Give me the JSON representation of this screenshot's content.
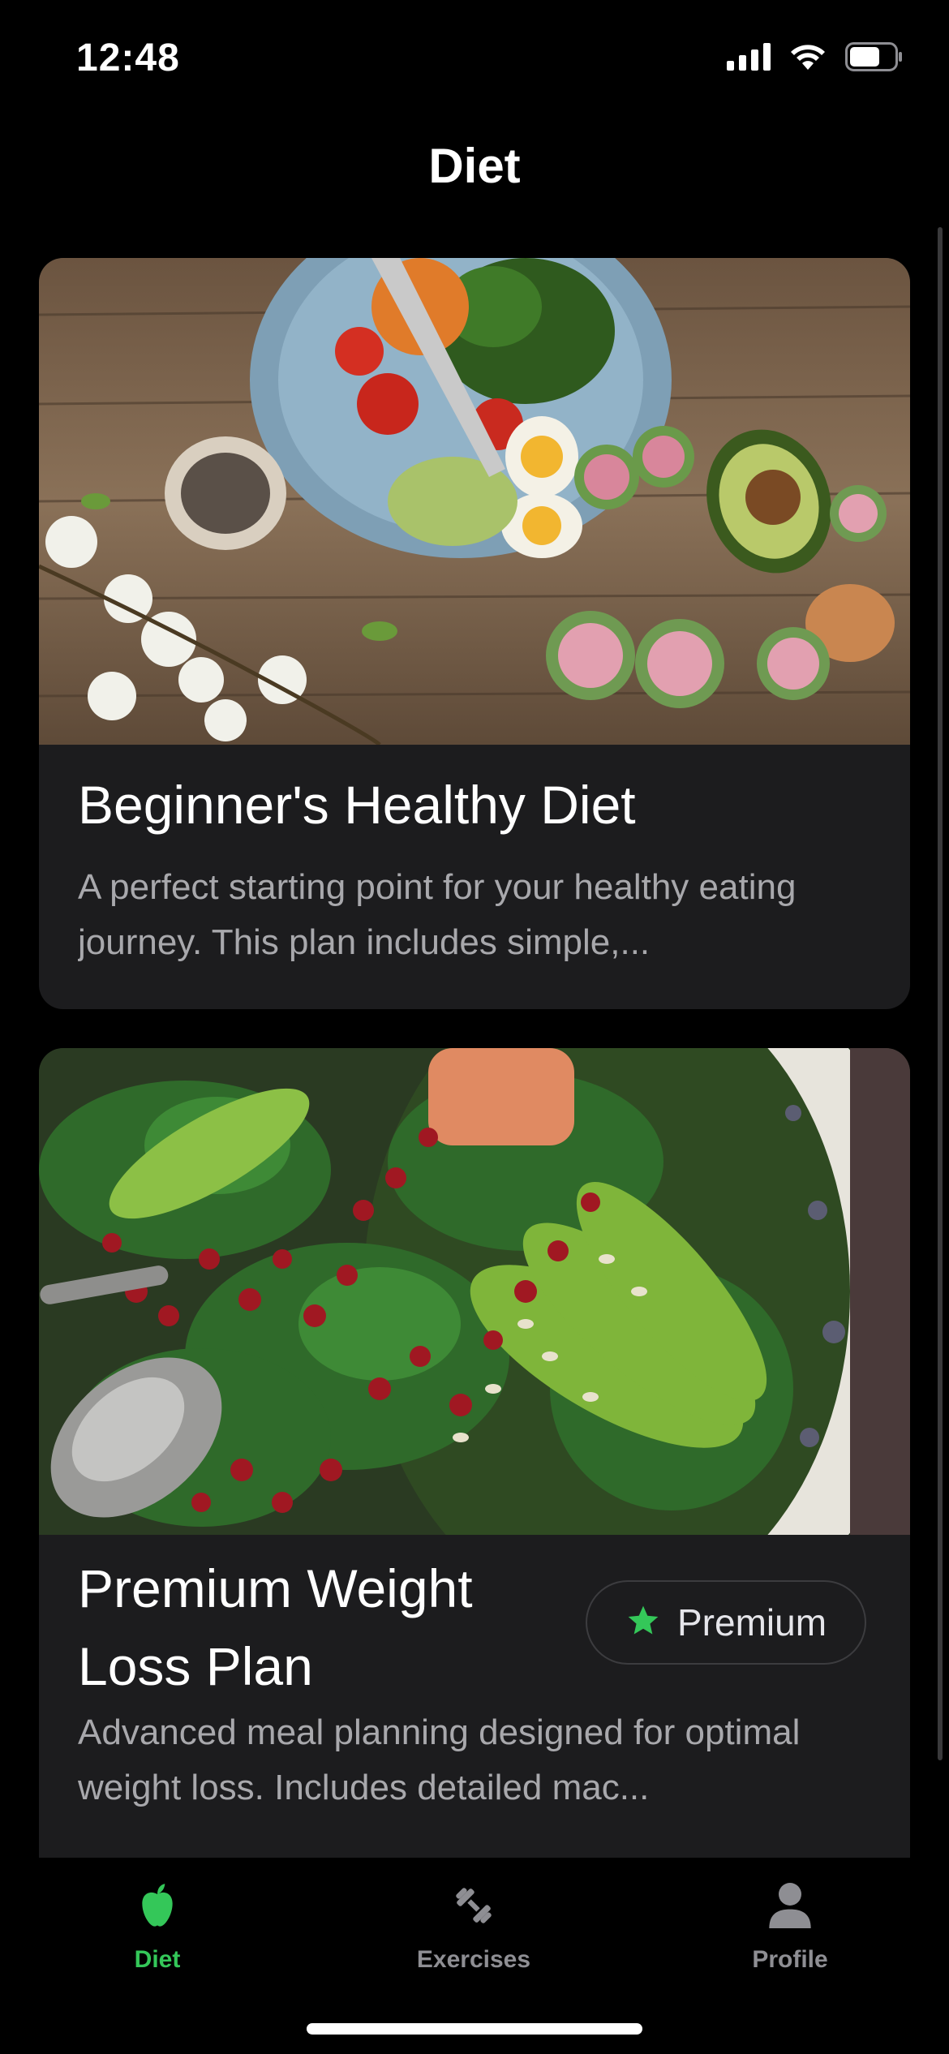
{
  "status_bar": {
    "time": "12:48",
    "icons": [
      "cellular-signal-icon",
      "wifi-icon",
      "battery-icon"
    ]
  },
  "header": {
    "title": "Diet"
  },
  "cards": [
    {
      "title": "Beginner's Healthy Diet",
      "description": "A perfect starting point for your healthy eating journey. This plan includes simple,...",
      "image": "salad-bowl-photo",
      "premium": false
    },
    {
      "title_line1": "Premium Weight",
      "title_line2": "Loss Plan",
      "description": "Advanced meal planning designed for optimal weight loss. Includes detailed mac...",
      "image": "spinach-avocado-salad-photo",
      "premium": true,
      "badge_label": "Premium"
    }
  ],
  "tab_bar": {
    "tabs": [
      {
        "label": "Diet",
        "icon": "apple-icon",
        "active": true
      },
      {
        "label": "Exercises",
        "icon": "dumbbell-icon",
        "active": false
      },
      {
        "label": "Profile",
        "icon": "person-icon",
        "active": false
      }
    ]
  },
  "colors": {
    "accent": "#34c759",
    "card_background": "#1c1c1e",
    "background": "#000000",
    "secondary_text": "#a8a8ac",
    "inactive_tab": "#8e8e93"
  }
}
